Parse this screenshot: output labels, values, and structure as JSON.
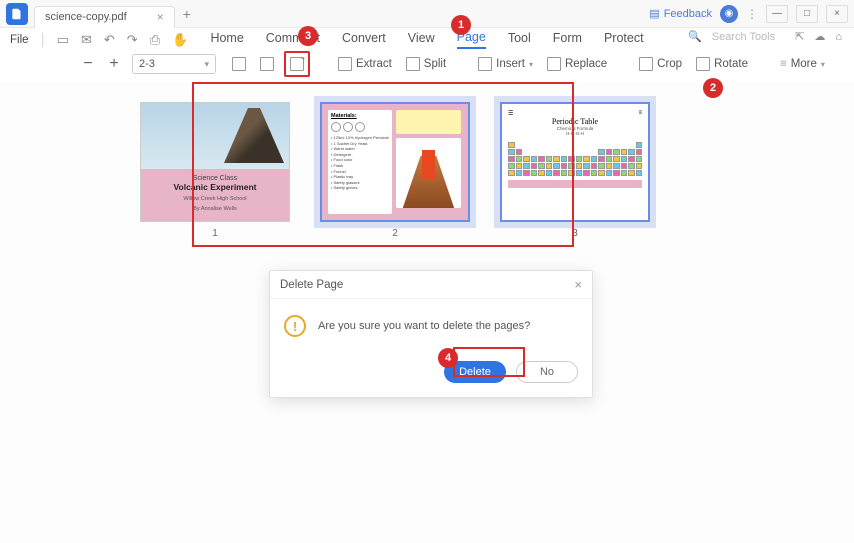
{
  "titlebar": {
    "tab_name": "science-copy.pdf",
    "feedback_label": "Feedback"
  },
  "file_menu": {
    "label": "File"
  },
  "main_tabs": {
    "home": "Home",
    "comment": "Comment",
    "convert": "Convert",
    "view": "View",
    "page": "Page",
    "tool": "Tool",
    "form": "Form",
    "protect": "Protect"
  },
  "search": {
    "placeholder": "Search Tools"
  },
  "toolbar": {
    "page_range": "2-3",
    "extract": "Extract",
    "split": "Split",
    "insert": "Insert",
    "replace": "Replace",
    "crop": "Crop",
    "rotate": "Rotate",
    "more": "More"
  },
  "thumbnails": {
    "page1": {
      "line1": "Science Class",
      "line2": "Volcanic Experiment",
      "line3": "Willow Creek High School",
      "line4": "By Annalise Wells",
      "num": "1"
    },
    "page2": {
      "materials_heading": "Materials:",
      "num": "2"
    },
    "page3": {
      "title": "Periodic Table",
      "subtitle1": "Chemical Formula",
      "subtitle2": "H-O-O-H",
      "num": "3"
    }
  },
  "dialog": {
    "title": "Delete Page",
    "message": "Are you sure you want to delete the pages?",
    "delete_btn": "Delete",
    "no_btn": "No"
  },
  "callouts": {
    "c1": "1",
    "c2": "2",
    "c3": "3",
    "c4": "4"
  }
}
